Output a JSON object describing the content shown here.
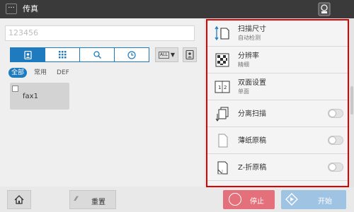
{
  "header": {
    "menu_glyph": "···",
    "title": "传真",
    "status_icon": "device-status-icon"
  },
  "destination": {
    "value": "123456"
  },
  "toolbar": {
    "tabs": [
      {
        "icon": "address-book-icon",
        "active": true
      },
      {
        "icon": "keypad-icon",
        "active": false
      },
      {
        "icon": "search-icon",
        "active": false
      },
      {
        "icon": "history-clock-icon",
        "active": false
      }
    ],
    "all_dropdown": "ALL",
    "book_button_icon": "address-book-list-icon"
  },
  "filters": [
    "全部",
    "常用",
    "DEF"
  ],
  "destinations": [
    {
      "name": "fax1",
      "checked": false
    }
  ],
  "settings": [
    {
      "label": "扫描尺寸",
      "value": "自动检测",
      "icon": "scan-size-icon",
      "toggle": null
    },
    {
      "label": "分辨率",
      "value": "精细",
      "icon": "resolution-icon",
      "toggle": null
    },
    {
      "label": "双面设置",
      "value": "单面",
      "icon": "duplex-icon",
      "toggle": null
    },
    {
      "label": "分离扫描",
      "value": "",
      "icon": "separate-scan-icon",
      "toggle": false
    },
    {
      "label": "薄纸原稿",
      "value": "",
      "icon": "thin-paper-icon",
      "toggle": false
    },
    {
      "label": "Z-折原稿",
      "value": "",
      "icon": "z-fold-icon",
      "toggle": false
    }
  ],
  "bottom": {
    "reset_label": "重置",
    "stop_label": "停止",
    "start_label": "开始"
  },
  "colors": {
    "accent": "#1e7bbf",
    "highlight_border": "#e00000",
    "stop": "#e3707a",
    "start_disabled": "#9fc3e3"
  }
}
